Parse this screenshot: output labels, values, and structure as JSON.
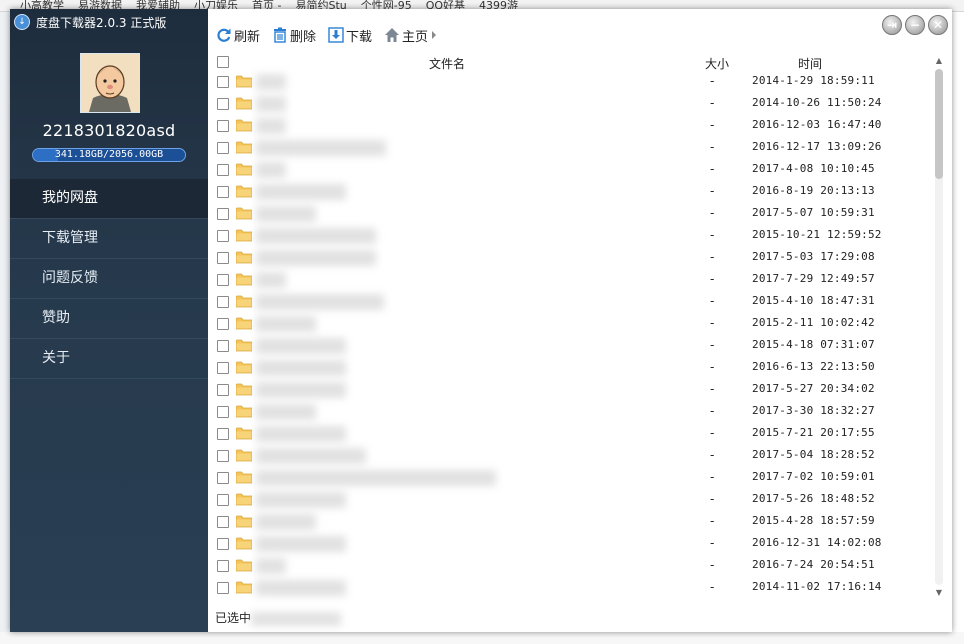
{
  "background": {
    "browser_tabs": [
      "小高教学",
      "易游数据",
      "我爱辅助",
      "小刀娱乐",
      "首页 -",
      "易简约Stu",
      "个性网-95",
      "QQ好基",
      "4399游"
    ]
  },
  "app": {
    "title": "度盘下载器2.0.3 正式版",
    "logo_icon": "download-circle-icon"
  },
  "user": {
    "name": "2218301820asd",
    "quota_text": "341.18GB/2056.00GB",
    "quota_fraction": 0.166
  },
  "nav": [
    {
      "label": "我的网盘",
      "active": true
    },
    {
      "label": "下载管理",
      "active": false
    },
    {
      "label": "问题反馈",
      "active": false
    },
    {
      "label": "赞助",
      "active": false
    },
    {
      "label": "关于",
      "active": false
    }
  ],
  "toolbar": {
    "refresh": "刷新",
    "delete": "删除",
    "download": "下载",
    "home": "主页"
  },
  "table": {
    "col_name": "文件名",
    "col_size": "大小",
    "col_time": "时间",
    "rows": [
      {
        "name": "",
        "size": "-",
        "time": "2014-1-29 18:59:11"
      },
      {
        "name": "",
        "size": "-",
        "time": "2014-10-26 11:50:24"
      },
      {
        "name": "",
        "size": "-",
        "time": "2016-12-03 16:47:40"
      },
      {
        "name": "",
        "size": "-",
        "time": "2016-12-17 13:09:26"
      },
      {
        "name": "",
        "size": "-",
        "time": "2017-4-08 10:10:45"
      },
      {
        "name": "",
        "size": "-",
        "time": "2016-8-19 20:13:13"
      },
      {
        "name": "",
        "size": "-",
        "time": "2017-5-07 10:59:31"
      },
      {
        "name": "",
        "size": "-",
        "time": "2015-10-21 12:59:52"
      },
      {
        "name": "",
        "size": "-",
        "time": "2017-5-03 17:29:08"
      },
      {
        "name": "",
        "size": "-",
        "time": "2017-7-29 12:49:57"
      },
      {
        "name": "",
        "size": "-",
        "time": "2015-4-10 18:47:31"
      },
      {
        "name": "",
        "size": "-",
        "time": "2015-2-11 10:02:42"
      },
      {
        "name": "",
        "size": "-",
        "time": "2015-4-18 07:31:07"
      },
      {
        "name": "",
        "size": "-",
        "time": "2016-6-13 22:13:50"
      },
      {
        "name": "",
        "size": "-",
        "time": "2017-5-27 20:34:02"
      },
      {
        "name": "",
        "size": "-",
        "time": "2017-3-30 18:32:27"
      },
      {
        "name": "",
        "size": "-",
        "time": "2015-7-21 20:17:55"
      },
      {
        "name": "",
        "size": "-",
        "time": "2017-5-04 18:28:52"
      },
      {
        "name": "",
        "size": "-",
        "time": "2017-7-02 10:59:01"
      },
      {
        "name": "",
        "size": "-",
        "time": "2017-5-26 18:48:52"
      },
      {
        "name": "",
        "size": "-",
        "time": "2015-4-28 18:57:59"
      },
      {
        "name": "",
        "size": "-",
        "time": "2016-12-31 14:02:08"
      },
      {
        "name": "",
        "size": "-",
        "time": "2016-7-24 20:54:51"
      },
      {
        "name": "",
        "size": "-",
        "time": "2014-11-02 17:16:14"
      }
    ]
  },
  "status": {
    "selected_prefix": "已选中"
  },
  "colors": {
    "sidebar_bg": "#26394c",
    "active_nav": "#1c2835",
    "folder": "#f5c55a",
    "quota_bar": "#1b4f96"
  }
}
